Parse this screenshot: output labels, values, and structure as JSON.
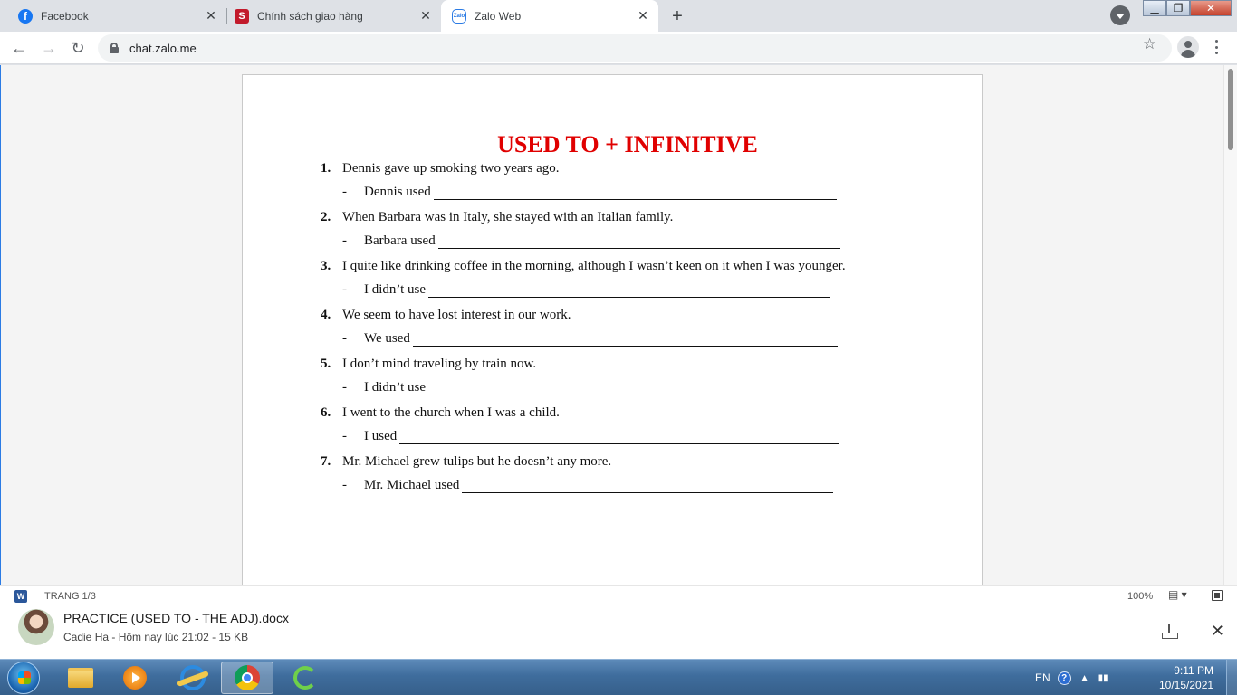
{
  "browser": {
    "tabs": [
      {
        "label": "Facebook",
        "icon": "facebook-icon",
        "active": false
      },
      {
        "label": "Chính sách giao hàng",
        "icon": "s-brand-icon",
        "active": false
      },
      {
        "label": "Zalo Web",
        "icon": "zalo-icon",
        "active": true
      }
    ],
    "new_tab": "+",
    "address": "chat.zalo.me"
  },
  "document": {
    "title": "USED TO + INFINITIVE",
    "title_color": "#e00000",
    "items": [
      {
        "num": "1.",
        "sentence": "Dennis gave up smoking two years ago.",
        "prompt": "Dennis used"
      },
      {
        "num": "2.",
        "sentence": "When Barbara was in Italy, she stayed with an Italian family.",
        "prompt": "Barbara used"
      },
      {
        "num": "3.",
        "sentence": "I quite like drinking coffee in the morning, although I wasn’t keen on it when I was younger.",
        "prompt": "I didn’t use"
      },
      {
        "num": "4.",
        "sentence": "We seem to have lost interest in our work.",
        "prompt": "We used"
      },
      {
        "num": "5.",
        "sentence": "I don’t mind traveling by train now.",
        "prompt": "I didn’t use"
      },
      {
        "num": "6.",
        "sentence": "I went to the church when I was a child.",
        "prompt": "I used"
      },
      {
        "num": "7.",
        "sentence": "Mr. Michael grew tulips but he doesn’t any more.",
        "prompt": "Mr. Michael used"
      }
    ],
    "answer_dash": "-"
  },
  "viewer": {
    "word_badge": "W",
    "page_info": "TRANG 1/3",
    "zoom": "100%",
    "view_mode": "▤ ▾"
  },
  "file": {
    "name": "PRACTICE (USED TO - THE ADJ).docx",
    "meta": "Cadie Ha - Hôm nay lúc 21:02 - 15 KB"
  },
  "taskbar": {
    "lang": "EN",
    "help": "?",
    "tray_glyph": "▲",
    "time": "9:11 PM",
    "date": "10/15/2021"
  },
  "colors": {
    "accent": "#2b7be4",
    "word_blue": "#2b579a"
  }
}
